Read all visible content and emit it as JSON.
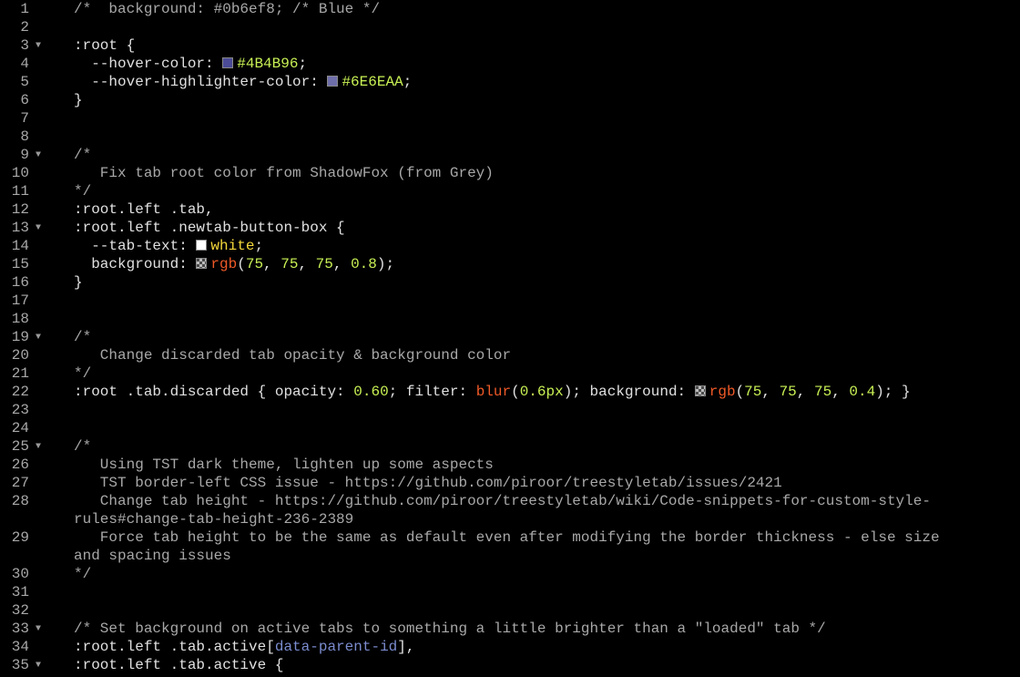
{
  "editor": {
    "lines": [
      {
        "n": "1",
        "fold": false,
        "tokens": [
          [
            "c-comment",
            "/*  background: #0b6ef8; /* Blue */"
          ]
        ]
      },
      {
        "n": "2",
        "fold": false,
        "tokens": []
      },
      {
        "n": "3",
        "fold": true,
        "tokens": [
          [
            "c-sel",
            ":root {"
          ]
        ]
      },
      {
        "n": "4",
        "fold": false,
        "tokens": [
          [
            "c-prop",
            "  --hover-color: "
          ],
          [
            "swatch",
            "#4B4B96"
          ],
          [
            "c-hex",
            "#4B4B96"
          ],
          [
            "c-punc",
            ";"
          ]
        ]
      },
      {
        "n": "5",
        "fold": false,
        "tokens": [
          [
            "c-prop",
            "  --hover-highlighter-color: "
          ],
          [
            "swatch",
            "#6E6EAA"
          ],
          [
            "c-hex",
            "#6E6EAA"
          ],
          [
            "c-punc",
            ";"
          ]
        ]
      },
      {
        "n": "6",
        "fold": false,
        "tokens": [
          [
            "c-punc",
            "}"
          ]
        ]
      },
      {
        "n": "7",
        "fold": false,
        "tokens": []
      },
      {
        "n": "8",
        "fold": false,
        "tokens": []
      },
      {
        "n": "9",
        "fold": true,
        "tokens": [
          [
            "c-comment",
            "/*"
          ]
        ]
      },
      {
        "n": "10",
        "fold": false,
        "tokens": [
          [
            "c-comment",
            "   Fix tab root color from ShadowFox (from Grey)"
          ]
        ]
      },
      {
        "n": "11",
        "fold": false,
        "tokens": [
          [
            "c-comment",
            "*/"
          ]
        ]
      },
      {
        "n": "12",
        "fold": false,
        "tokens": [
          [
            "c-sel",
            ":root.left .tab,"
          ]
        ]
      },
      {
        "n": "13",
        "fold": true,
        "tokens": [
          [
            "c-sel",
            ":root.left .newtab-button-box {"
          ]
        ]
      },
      {
        "n": "14",
        "fold": false,
        "tokens": [
          [
            "c-prop",
            "  --tab-text: "
          ],
          [
            "swatch",
            "#ffffff"
          ],
          [
            "c-kw",
            "white"
          ],
          [
            "c-punc",
            ";"
          ]
        ]
      },
      {
        "n": "15",
        "fold": false,
        "tokens": [
          [
            "c-prop",
            "  background: "
          ],
          [
            "swatch-checker",
            "#4b4b4b"
          ],
          [
            "c-func",
            "rgb"
          ],
          [
            "c-punc",
            "("
          ],
          [
            "c-num",
            "75"
          ],
          [
            "c-punc",
            ", "
          ],
          [
            "c-num",
            "75"
          ],
          [
            "c-punc",
            ", "
          ],
          [
            "c-num",
            "75"
          ],
          [
            "c-punc",
            ", "
          ],
          [
            "c-num",
            "0.8"
          ],
          [
            "c-punc",
            ");"
          ]
        ]
      },
      {
        "n": "16",
        "fold": false,
        "tokens": [
          [
            "c-punc",
            "}"
          ]
        ]
      },
      {
        "n": "17",
        "fold": false,
        "tokens": []
      },
      {
        "n": "18",
        "fold": false,
        "tokens": []
      },
      {
        "n": "19",
        "fold": true,
        "tokens": [
          [
            "c-comment",
            "/*"
          ]
        ]
      },
      {
        "n": "20",
        "fold": false,
        "tokens": [
          [
            "c-comment",
            "   Change discarded tab opacity & background color"
          ]
        ]
      },
      {
        "n": "21",
        "fold": false,
        "tokens": [
          [
            "c-comment",
            "*/"
          ]
        ]
      },
      {
        "n": "22",
        "fold": false,
        "tokens": [
          [
            "c-sel",
            ":root .tab.discarded { "
          ],
          [
            "c-prop",
            "opacity: "
          ],
          [
            "c-num",
            "0.60"
          ],
          [
            "c-punc",
            "; "
          ],
          [
            "c-prop",
            "filter: "
          ],
          [
            "c-func",
            "blur"
          ],
          [
            "c-punc",
            "("
          ],
          [
            "c-num",
            "0.6px"
          ],
          [
            "c-punc",
            "); "
          ],
          [
            "c-prop",
            "background: "
          ],
          [
            "swatch-checker",
            "#4b4b4b"
          ],
          [
            "c-func",
            "rgb"
          ],
          [
            "c-punc",
            "("
          ],
          [
            "c-num",
            "75"
          ],
          [
            "c-punc",
            ", "
          ],
          [
            "c-num",
            "75"
          ],
          [
            "c-punc",
            ", "
          ],
          [
            "c-num",
            "75"
          ],
          [
            "c-punc",
            ", "
          ],
          [
            "c-num",
            "0.4"
          ],
          [
            "c-punc",
            "); }"
          ]
        ]
      },
      {
        "n": "23",
        "fold": false,
        "tokens": []
      },
      {
        "n": "24",
        "fold": false,
        "tokens": []
      },
      {
        "n": "25",
        "fold": true,
        "tokens": [
          [
            "c-comment",
            "/*"
          ]
        ]
      },
      {
        "n": "26",
        "fold": false,
        "tokens": [
          [
            "c-comment",
            "   Using TST dark theme, lighten up some aspects"
          ]
        ]
      },
      {
        "n": "27",
        "fold": false,
        "tokens": [
          [
            "c-comment",
            "   TST border-left CSS issue - https://github.com/piroor/treestyletab/issues/2421"
          ]
        ]
      },
      {
        "n": "28",
        "fold": false,
        "tokens": [
          [
            "c-comment",
            "   Change tab height - https://github.com/piroor/treestyletab/wiki/Code-snippets-for-custom-style-"
          ]
        ]
      },
      {
        "n": "",
        "fold": false,
        "tokens": [
          [
            "c-comment",
            "rules#change-tab-height-236-2389"
          ]
        ]
      },
      {
        "n": "29",
        "fold": false,
        "tokens": [
          [
            "c-comment",
            "   Force tab height to be the same as default even after modifying the border thickness - else size"
          ]
        ]
      },
      {
        "n": "",
        "fold": false,
        "tokens": [
          [
            "c-comment",
            "and spacing issues"
          ]
        ]
      },
      {
        "n": "30",
        "fold": false,
        "tokens": [
          [
            "c-comment",
            "*/"
          ]
        ]
      },
      {
        "n": "31",
        "fold": false,
        "tokens": []
      },
      {
        "n": "32",
        "fold": false,
        "tokens": []
      },
      {
        "n": "33",
        "fold": true,
        "tokens": [
          [
            "c-comment",
            "/* Set background on active tabs to something a little brighter than a \"loaded\" tab */"
          ]
        ]
      },
      {
        "n": "34",
        "fold": false,
        "tokens": [
          [
            "c-sel",
            ":root.left .tab.active["
          ],
          [
            "c-attr",
            "data-parent-id"
          ],
          [
            "c-sel",
            "],"
          ]
        ]
      },
      {
        "n": "35",
        "fold": true,
        "tokens": [
          [
            "c-sel",
            ":root.left .tab.active {"
          ]
        ]
      }
    ],
    "fold_glyph": "▼"
  }
}
